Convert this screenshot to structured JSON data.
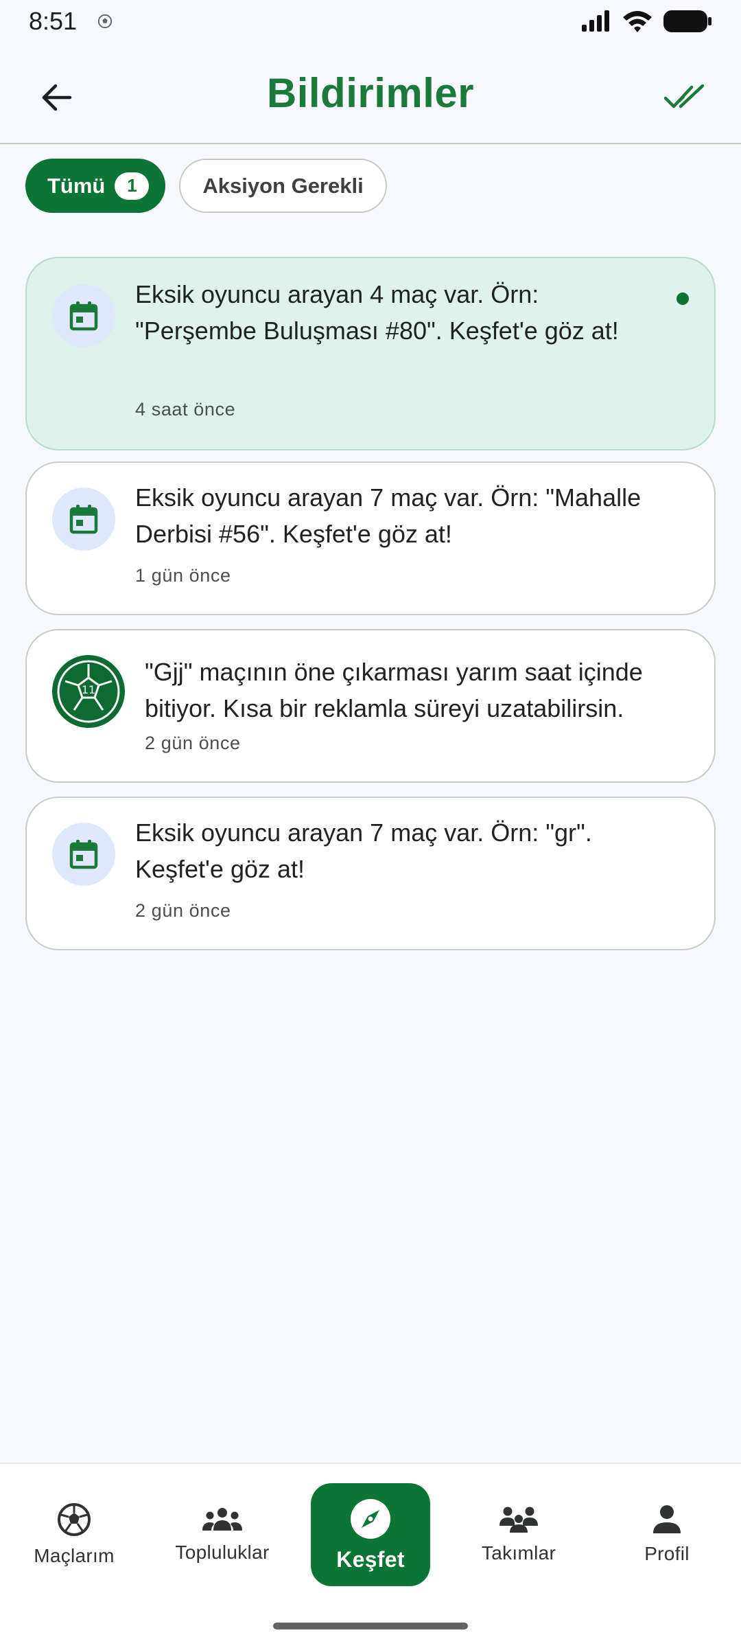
{
  "status_bar": {
    "time": "8:51",
    "app_icon": "soccer-ball-icon",
    "icons": [
      "signal-icon",
      "wifi-icon",
      "battery-icon"
    ]
  },
  "header": {
    "title": "Bildirimler",
    "back_icon": "arrow-left-icon",
    "mark_all_read_icon": "double-check-icon"
  },
  "filters": {
    "all_label": "Tümü",
    "all_count": "1",
    "action_label": "Aksiyon Gerekli"
  },
  "notifications": [
    {
      "icon": "calendar-icon",
      "text": "Eksik oyuncu arayan 4 maç var. Örn: \"Perşembe Buluşması #80\". Keşfet'e göz at!",
      "time": "4 saat önce",
      "unread": true
    },
    {
      "icon": "calendar-icon",
      "text": "Eksik oyuncu arayan 7 maç var. Örn: \"Mahalle Derbisi #56\". Keşfet'e göz at!",
      "time": "1 gün önce",
      "unread": false
    },
    {
      "icon": "soccer-ball-icon",
      "ball_number": "11",
      "text": "\"Gjj\" maçının öne çıkarması yarım saat içinde bitiyor. Kısa bir reklamla süreyi uzatabilirsin.",
      "time": "2 gün önce",
      "unread": false
    },
    {
      "icon": "calendar-icon",
      "text": "Eksik oyuncu arayan 7 maç var. Örn: \"gr\". Keşfet'e göz at!",
      "time": "2 gün önce",
      "unread": false
    }
  ],
  "bottom_nav": {
    "items": [
      {
        "label": "Maçlarım",
        "icon": "soccer-ball-icon"
      },
      {
        "label": "Topluluklar",
        "icon": "people-group-icon"
      },
      {
        "label": "Keşfet",
        "icon": "compass-icon",
        "active": true
      },
      {
        "label": "Takımlar",
        "icon": "team-icon"
      },
      {
        "label": "Profil",
        "icon": "person-icon"
      }
    ]
  },
  "colors": {
    "brand_green": "#0c7434",
    "title_green": "#1a7a3b",
    "unread_card_bg": "#dff3ec",
    "page_bg": "#f7f8fe"
  }
}
